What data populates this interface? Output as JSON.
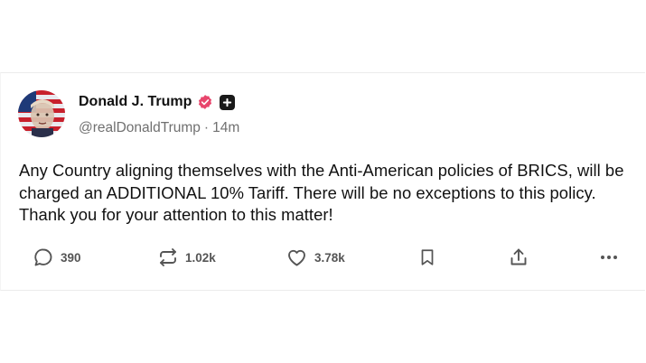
{
  "post": {
    "author_name": "Donald J. Trump",
    "handle": "@realDonaldTrump",
    "separator": "·",
    "time": "14m",
    "body": "Any Country aligning themselves with the Anti-American policies of BRICS, will be charged an ADDITIONAL 10% Tariff. There will be no exceptions to this policy. Thank you for your attention to this matter!"
  },
  "actions": {
    "replies": "390",
    "reposts": "1.02k",
    "likes": "3.78k"
  },
  "colors": {
    "verified": "#e8456c",
    "text": "#111111",
    "muted": "#707070"
  },
  "icons": [
    "avatar-image",
    "verified-badge-icon",
    "plus-badge-icon",
    "reply-icon",
    "repost-icon",
    "like-icon",
    "bookmark-icon",
    "share-icon",
    "more-icon"
  ]
}
